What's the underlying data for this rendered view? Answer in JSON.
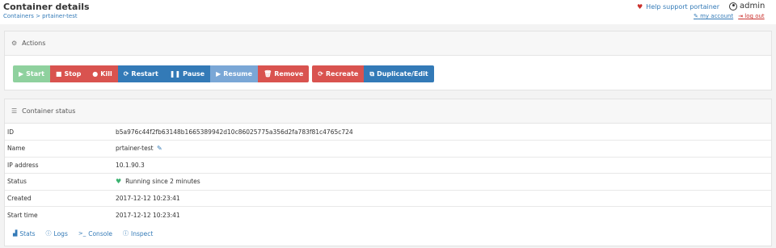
{
  "header": {
    "title": "Container details",
    "breadcrumb": "Containers > prtainer-test",
    "help_label": "Help support portainer",
    "user": "admin",
    "my_account": "my account",
    "log_out": "log out"
  },
  "actions": {
    "title": "Actions",
    "buttons": {
      "start": "Start",
      "stop": "Stop",
      "kill": "Kill",
      "restart": "Restart",
      "pause": "Pause",
      "resume": "Resume",
      "remove": "Remove",
      "recreate": "Recreate",
      "duplicate": "Duplicate/Edit"
    }
  },
  "status": {
    "title": "Container status",
    "rows": [
      {
        "label": "ID",
        "value": "b5a976c44f2fb63148b1665389942d10c86025775a356d2fa783f81c4765c724"
      },
      {
        "label": "Name",
        "value": "prtainer-test"
      },
      {
        "label": "IP address",
        "value": "10.1.90.3"
      },
      {
        "label": "Status",
        "value": "Running since 2 minutes"
      },
      {
        "label": "Created",
        "value": "2017-12-12 10:23:41"
      },
      {
        "label": "Start time",
        "value": "2017-12-12 10:23:41"
      }
    ],
    "links": {
      "stats": "Stats",
      "logs": "Logs",
      "console": "Console",
      "inspect": "Inspect"
    }
  },
  "colors": {
    "primary": "#337ab7",
    "danger": "#d9534f",
    "success": "#8fd19e"
  }
}
